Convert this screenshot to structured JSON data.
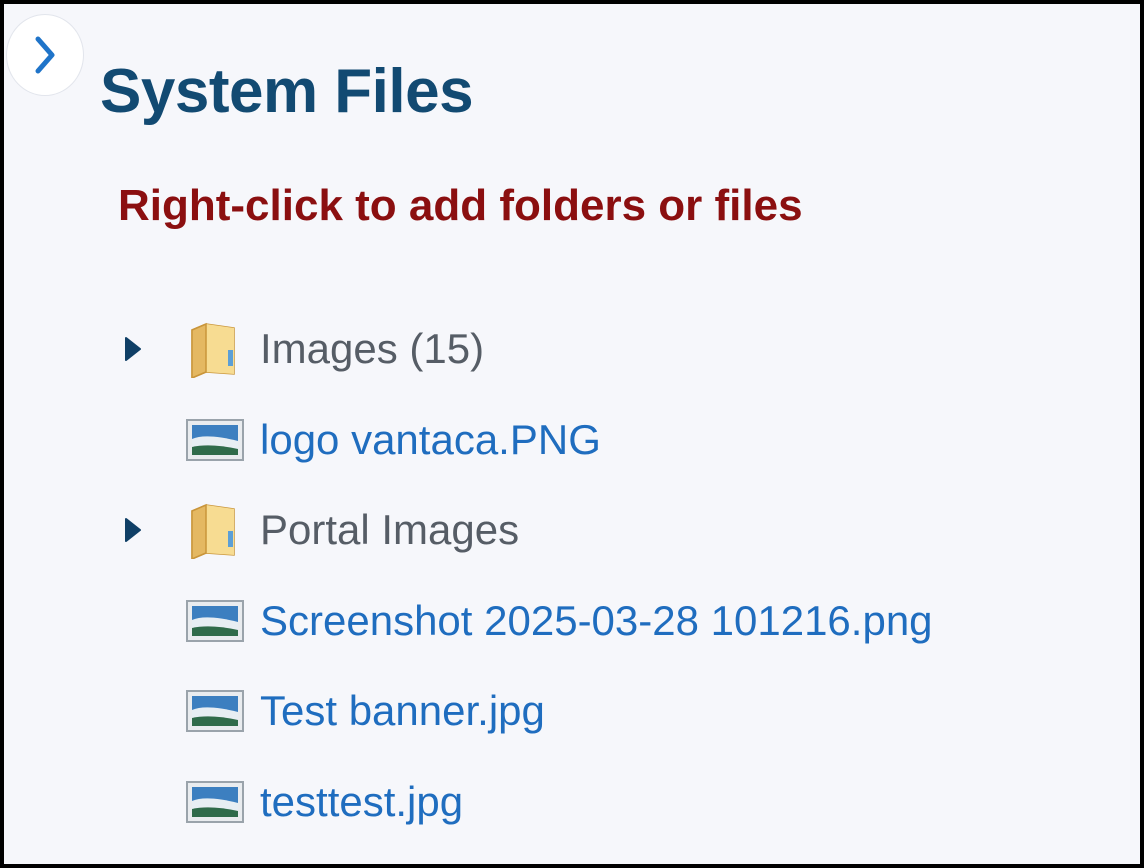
{
  "panel": {
    "title": "System Files",
    "hint": "Right-click to add folders or files"
  },
  "colors": {
    "title": "#124a72",
    "hint": "#8b0f10",
    "folder_label": "#565d66",
    "file_link": "#1f6dbf",
    "background": "#f6f7fb"
  },
  "tree": {
    "items": [
      {
        "type": "folder",
        "label": "Images (15)",
        "icon": "folder-icon",
        "expanded": false
      },
      {
        "type": "file",
        "label": "logo vantaca.PNG",
        "icon": "image-file-icon"
      },
      {
        "type": "folder",
        "label": "Portal Images",
        "icon": "folder-icon",
        "expanded": false
      },
      {
        "type": "file",
        "label": "Screenshot 2025-03-28 101216.png",
        "icon": "image-file-icon"
      },
      {
        "type": "file",
        "label": "Test banner.jpg",
        "icon": "image-file-icon"
      },
      {
        "type": "file",
        "label": "testtest.jpg",
        "icon": "image-file-icon"
      }
    ]
  }
}
